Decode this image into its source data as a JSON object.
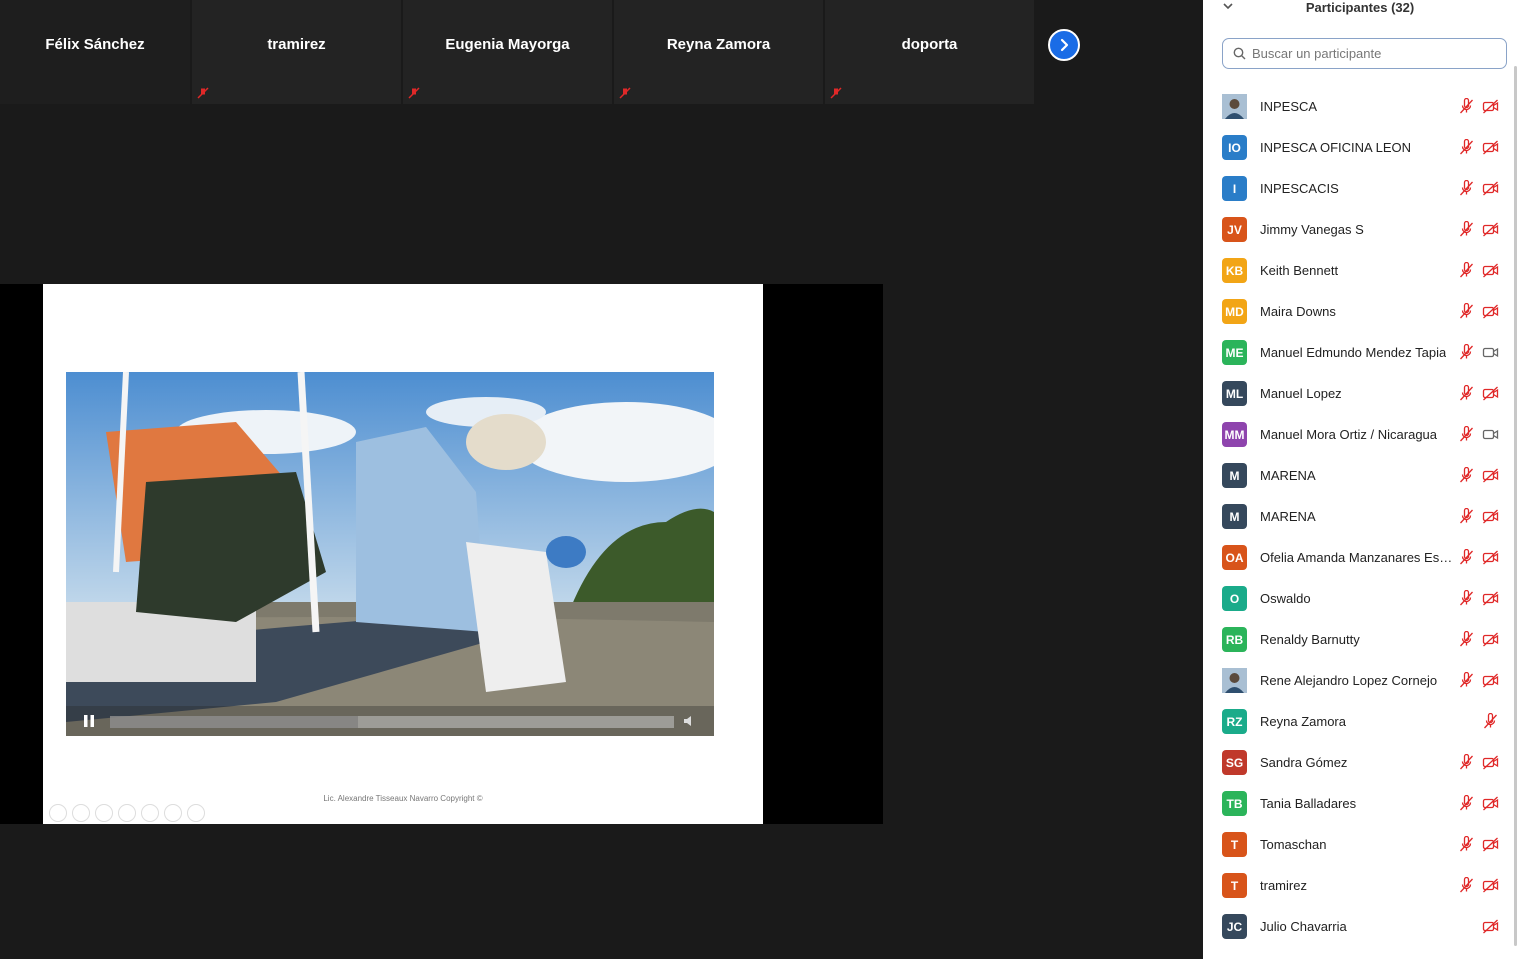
{
  "gallery": {
    "tiles": [
      {
        "name": "Félix Sánchez",
        "muted": false
      },
      {
        "name": "tramirez",
        "muted": true
      },
      {
        "name": "Eugenia Mayorga",
        "muted": true
      },
      {
        "name": "Reyna Zamora",
        "muted": true
      },
      {
        "name": "doporta",
        "muted": true
      }
    ],
    "next_icon": "chevron-right-icon"
  },
  "share": {
    "credit": "Lic. Alexandre Tisseaux Navarro Copyright ©",
    "video_progress": 0.44
  },
  "panel": {
    "title": "Participantes (32)",
    "search_placeholder": "Buscar un participante",
    "participants": [
      {
        "initials": "",
        "name": "INPESCA",
        "color": "#4a6d8c",
        "photo": true,
        "mic": "muted",
        "cam": "off"
      },
      {
        "initials": "IO",
        "name": "INPESCA OFICINA LEON",
        "color": "#2a7dc8",
        "mic": "muted",
        "cam": "off"
      },
      {
        "initials": "I",
        "name": "INPESCACIS",
        "color": "#2a7dc8",
        "mic": "muted",
        "cam": "off"
      },
      {
        "initials": "JV",
        "name": "Jimmy Vanegas S",
        "color": "#d8541a",
        "mic": "muted",
        "cam": "off"
      },
      {
        "initials": "KB",
        "name": "Keith Bennett",
        "color": "#f2a516",
        "mic": "muted",
        "cam": "off"
      },
      {
        "initials": "MD",
        "name": "Maira Downs",
        "color": "#f2a516",
        "mic": "muted",
        "cam": "off"
      },
      {
        "initials": "ME",
        "name": "Manuel Edmundo Mendez Tapia",
        "color": "#2bb45a",
        "mic": "muted",
        "cam": "on"
      },
      {
        "initials": "ML",
        "name": "Manuel Lopez",
        "color": "#35485c",
        "mic": "muted",
        "cam": "off"
      },
      {
        "initials": "MM",
        "name": "Manuel Mora Ortiz / Nicaragua",
        "color": "#8e44ad",
        "mic": "muted",
        "cam": "on"
      },
      {
        "initials": "M",
        "name": "MARENA",
        "color": "#35485c",
        "mic": "muted",
        "cam": "off"
      },
      {
        "initials": "M",
        "name": "MARENA",
        "color": "#35485c",
        "mic": "muted",
        "cam": "off"
      },
      {
        "initials": "OA",
        "name": "Ofelia Amanda Manzanares Esp...",
        "color": "#d8541a",
        "mic": "muted",
        "cam": "off"
      },
      {
        "initials": "O",
        "name": "Oswaldo",
        "color": "#1aab8a",
        "mic": "muted",
        "cam": "off"
      },
      {
        "initials": "RB",
        "name": "Renaldy Barnutty",
        "color": "#2bb45a",
        "mic": "muted",
        "cam": "off"
      },
      {
        "initials": "",
        "name": "Rene Alejandro Lopez Cornejo",
        "color": "#9fb8cc",
        "photo": true,
        "mic": "muted",
        "cam": "off"
      },
      {
        "initials": "RZ",
        "name": "Reyna Zamora",
        "color": "#1aab8a",
        "mic": "none",
        "cam": "mutedonly"
      },
      {
        "initials": "SG",
        "name": "Sandra Gómez",
        "color": "#c0392b",
        "mic": "muted",
        "cam": "off"
      },
      {
        "initials": "TB",
        "name": "Tania Balladares",
        "color": "#2bb45a",
        "mic": "muted",
        "cam": "off"
      },
      {
        "initials": "T",
        "name": "Tomaschan",
        "color": "#d8541a",
        "mic": "muted",
        "cam": "off"
      },
      {
        "initials": "T",
        "name": "tramirez",
        "color": "#d8541a",
        "mic": "muted",
        "cam": "off"
      },
      {
        "initials": "JC",
        "name": "Julio Chavarria",
        "color": "#35485c",
        "mic": "none",
        "cam": "off"
      }
    ]
  }
}
